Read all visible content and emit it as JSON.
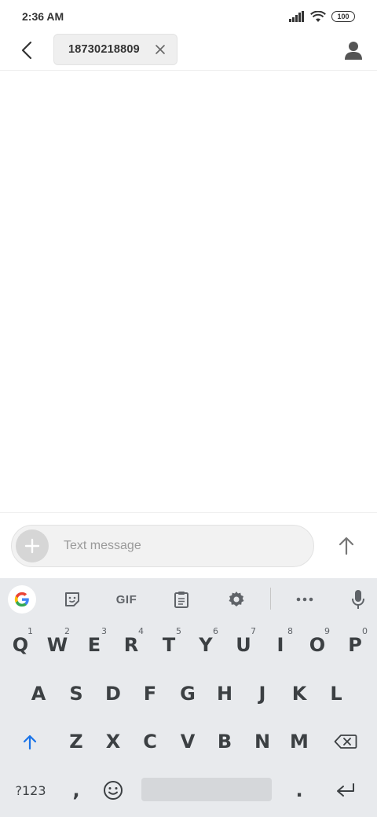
{
  "status_bar": {
    "time": "2:36 AM",
    "battery": "100"
  },
  "header": {
    "recipient": "18730218809"
  },
  "compose": {
    "placeholder": "Text message"
  },
  "keyboard": {
    "toolbar": {
      "gif_label": "GIF"
    },
    "row1": [
      {
        "key": "Q",
        "hint": "1"
      },
      {
        "key": "W",
        "hint": "2"
      },
      {
        "key": "E",
        "hint": "3"
      },
      {
        "key": "R",
        "hint": "4"
      },
      {
        "key": "T",
        "hint": "5"
      },
      {
        "key": "Y",
        "hint": "6"
      },
      {
        "key": "U",
        "hint": "7"
      },
      {
        "key": "I",
        "hint": "8"
      },
      {
        "key": "O",
        "hint": "9"
      },
      {
        "key": "P",
        "hint": "0"
      }
    ],
    "row2": [
      "A",
      "S",
      "D",
      "F",
      "G",
      "H",
      "J",
      "K",
      "L"
    ],
    "row3": [
      "Z",
      "X",
      "C",
      "V",
      "B",
      "N",
      "M"
    ],
    "row4": {
      "symbols_label": "?123",
      "comma": ",",
      "period": "."
    }
  }
}
